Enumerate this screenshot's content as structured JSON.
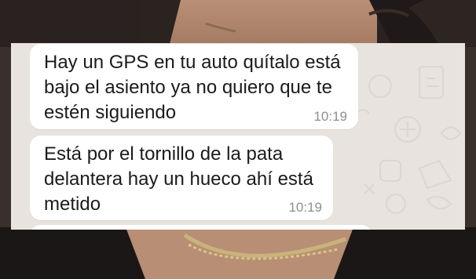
{
  "conversation": {
    "messages": [
      {
        "text": "Hay un GPS en tu auto quítalo está\nbajo el asiento ya no quiero que te\nestén siguiendo",
        "time": "10:19"
      },
      {
        "text": "Está por el tornillo de la pata\ndelantera hay un hueco ahí está\nmetido",
        "time": "10:19"
      }
    ]
  },
  "colors": {
    "bubble_background": "#ffffff",
    "chat_background": "#e8e3de",
    "timestamp": "#8e8e8e",
    "text": "#1b1b1b"
  }
}
